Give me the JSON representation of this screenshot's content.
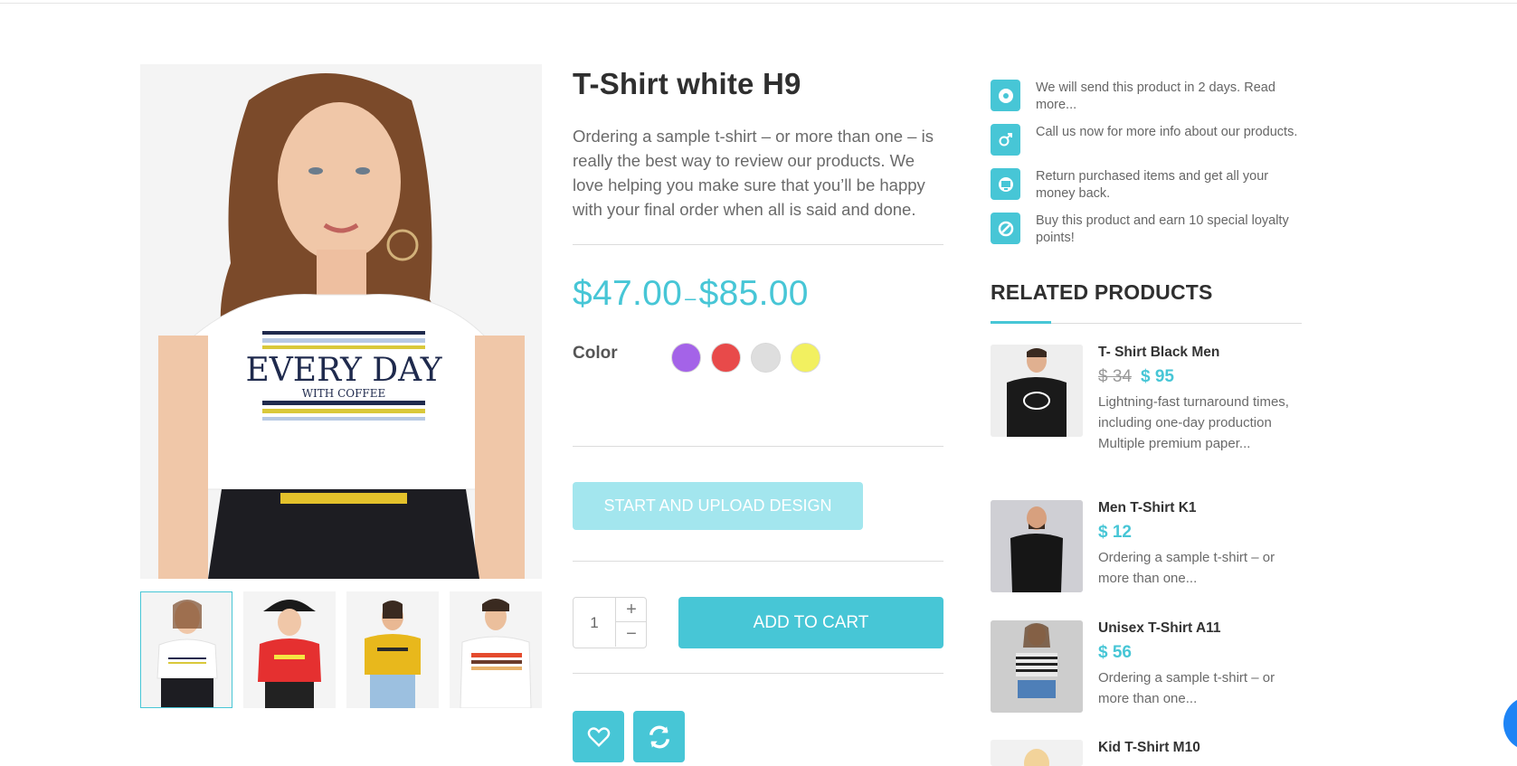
{
  "gallery": {
    "main_image": "Woman in white EVERY DAY t-shirt",
    "main_print_line1": "EVERY DAY",
    "main_print_line2": "WITH COFFEE",
    "thumbnails": [
      {
        "label": "White t-shirt",
        "active": true
      },
      {
        "label": "Red t-shirt"
      },
      {
        "label": "Yellow t-shirt"
      },
      {
        "label": "Striped white t-shirt"
      }
    ]
  },
  "product": {
    "title": "T-Shirt white H9",
    "description": "Ordering a sample t-shirt – or more than one – is really the best way to review our products. We love helping you make sure that you’ll be happy with your final order when all is said and done.",
    "price_min": "$47.00",
    "price_sep": "–",
    "price_max": "$85.00",
    "color_label": "Color",
    "colors": [
      "#a463e8",
      "#e84a4a",
      "#dedede",
      "#f2f060"
    ],
    "upload_label": "START AND UPLOAD DESIGN",
    "quantity": "1",
    "qty_plus": "+",
    "qty_minus": "−",
    "add_to_cart": "ADD TO CART",
    "accent_color": "#47c6d6"
  },
  "features": [
    {
      "icon": "gear-icon",
      "text": "We will send this product in 2 days. Read more..."
    },
    {
      "icon": "gender-icon",
      "text": "Call us now for more info about our products."
    },
    {
      "icon": "monitor-icon",
      "text": "Return purchased items and get all your money back."
    },
    {
      "icon": "ban-icon",
      "text": "Buy this product and earn 10 special loyalty points!"
    }
  ],
  "related": {
    "title": "RELATED PRODUCTS",
    "items": [
      {
        "name": "T- Shirt Black Men",
        "old_price": "$ 34",
        "price": "$ 95",
        "desc": "Lightning-fast turnaround times, including one-day production Multiple premium paper..."
      },
      {
        "name": "Men T-Shirt K1",
        "price": "$ 12",
        "desc": "Ordering a sample t-shirt – or more than one..."
      },
      {
        "name": "Unisex T-Shirt A11",
        "price": "$ 56",
        "desc": "Ordering a sample t-shirt – or more than one..."
      },
      {
        "name": "Kid T-Shirt M10"
      }
    ]
  }
}
